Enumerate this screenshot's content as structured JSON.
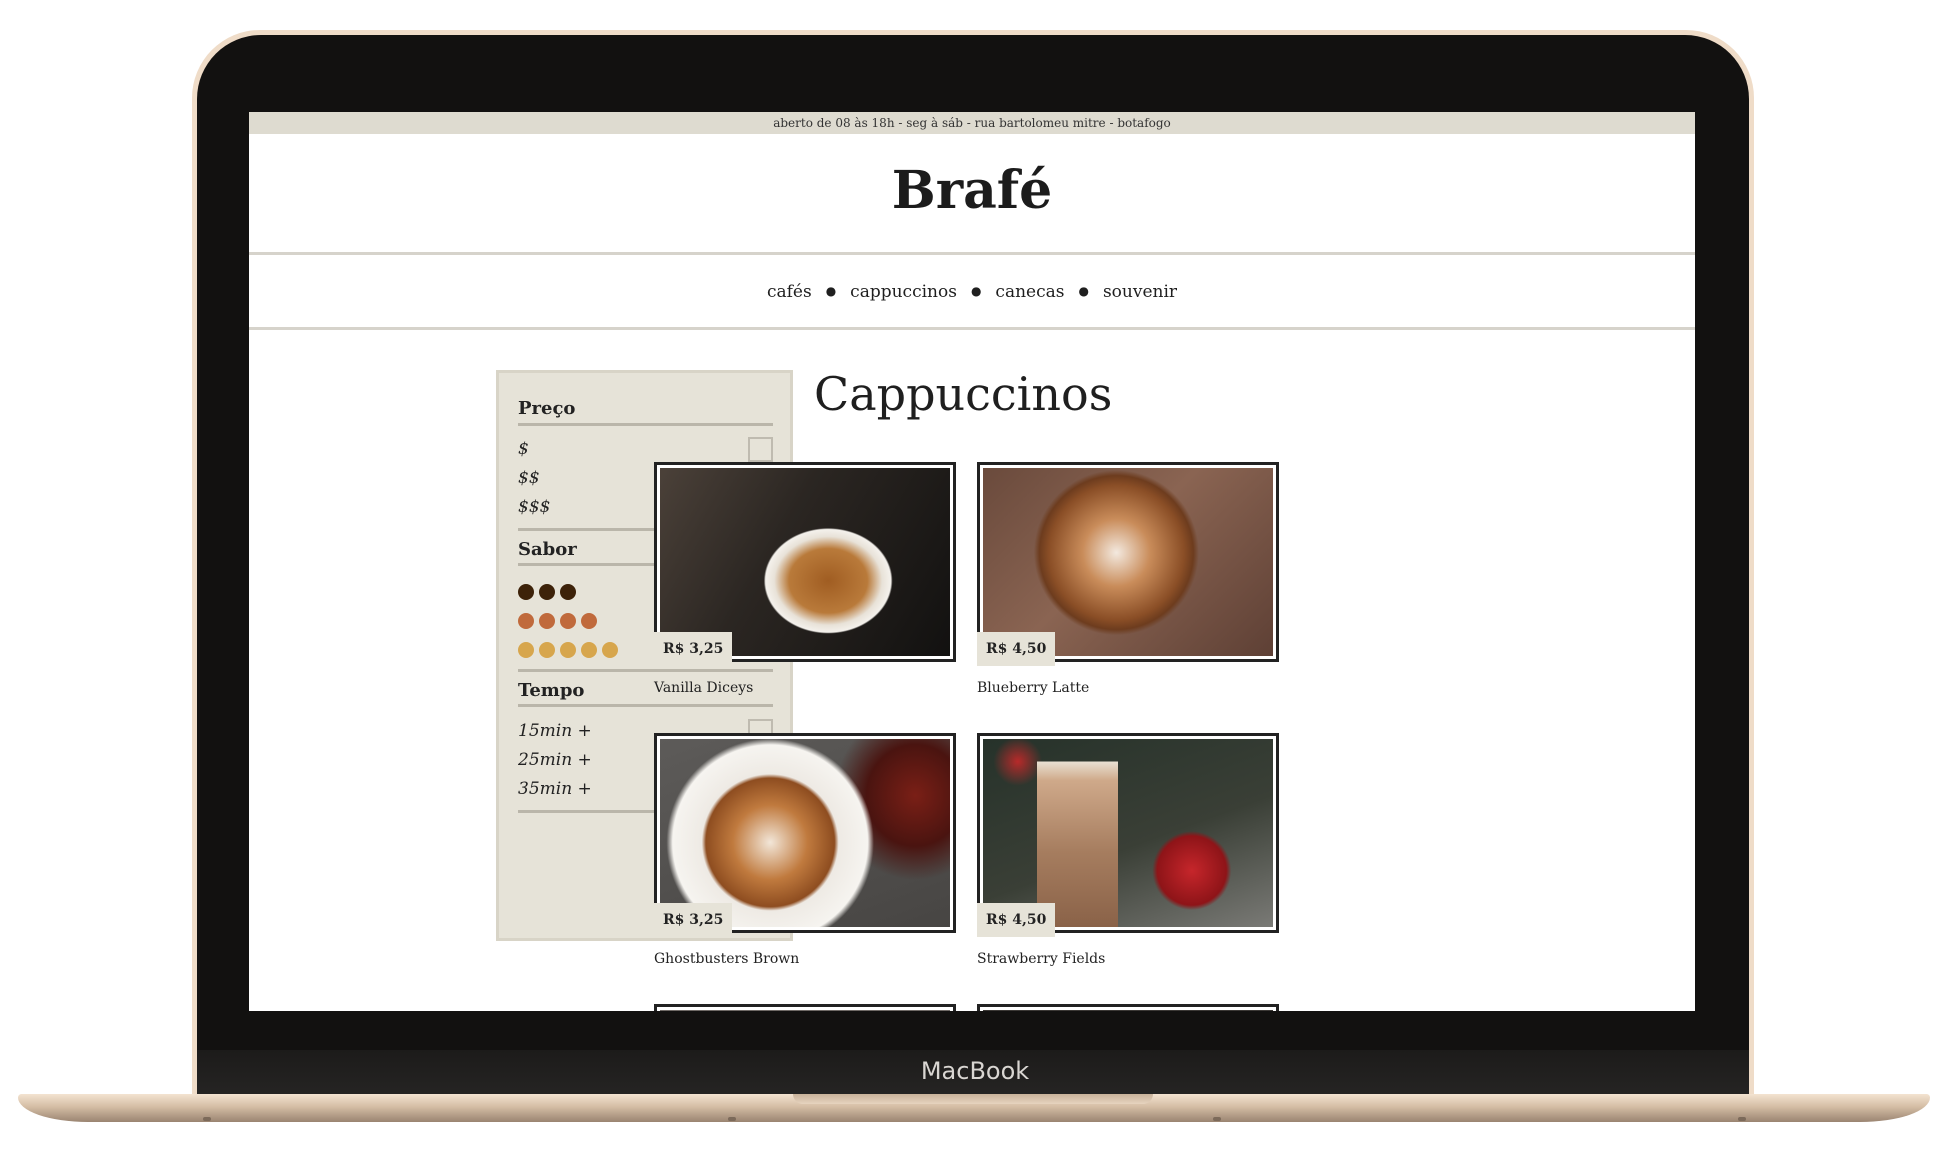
{
  "device": {
    "brand": "MacBook"
  },
  "site": {
    "info_bar": "aberto de 08 às 18h - seg à sáb - rua bartolomeu mitre - botafogo",
    "logo": "Brafé",
    "nav": [
      "cafés",
      "cappuccinos",
      "canecas",
      "souvenir"
    ]
  },
  "filters": {
    "price": {
      "title": "Preço",
      "options": [
        "$",
        "$$",
        "$$$"
      ]
    },
    "flavor": {
      "title": "Sabor",
      "levels": [
        {
          "count": 3,
          "color": "#3d2209"
        },
        {
          "count": 4,
          "color": "#c06a3c"
        },
        {
          "count": 5,
          "color": "#d7a64d"
        }
      ]
    },
    "time": {
      "title": "Tempo",
      "options": [
        "15min +",
        "25min +",
        "35min +"
      ]
    }
  },
  "main": {
    "heading": "Cappuccinos",
    "products": [
      {
        "price": "R$ 3,25",
        "name": "Vanilla Diceys"
      },
      {
        "price": "R$ 4,50",
        "name": "Blueberry Latte"
      },
      {
        "price": "R$ 3,25",
        "name": "Ghostbusters Brown"
      },
      {
        "price": "R$ 4,50",
        "name": "Strawberry Fields"
      }
    ]
  }
}
